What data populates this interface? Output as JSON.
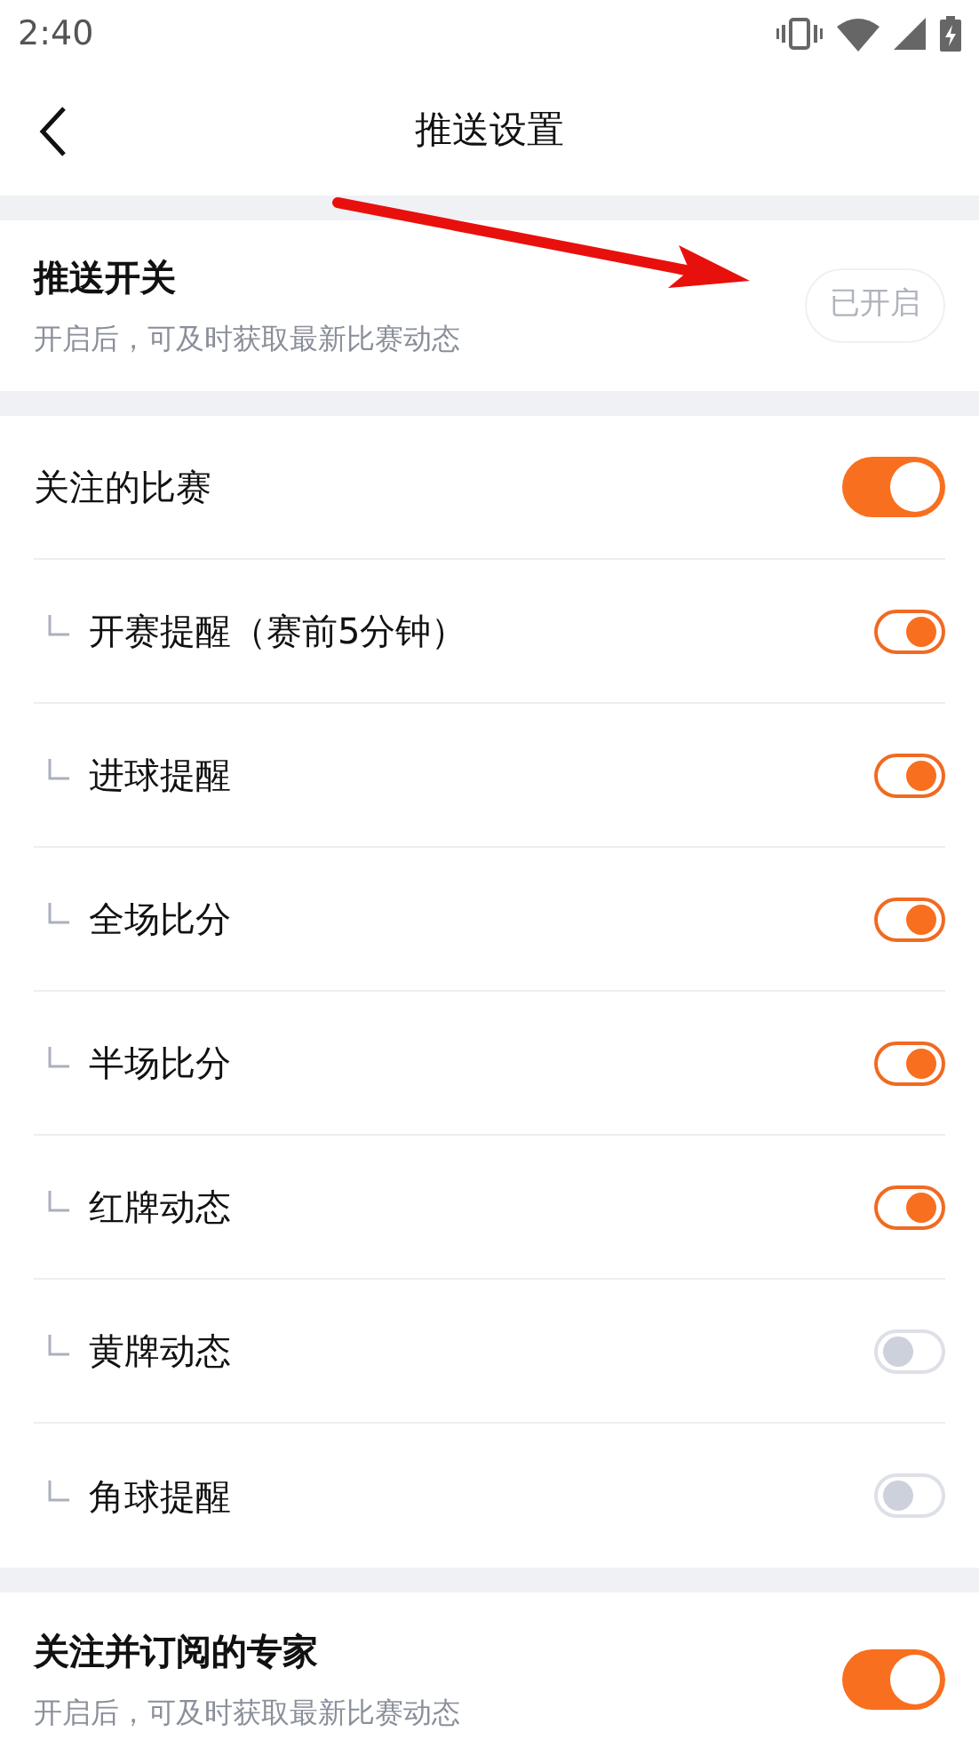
{
  "status_bar": {
    "time": "2:40"
  },
  "nav": {
    "title": "推送设置"
  },
  "push": {
    "title": "推送开关",
    "description": "开启后，可及时获取最新比赛动态",
    "status": "已开启"
  },
  "matches": {
    "title": "关注的比赛",
    "on": true,
    "items": [
      {
        "label": "开赛提醒（赛前5分钟）",
        "on": true
      },
      {
        "label": "进球提醒",
        "on": true
      },
      {
        "label": "全场比分",
        "on": true
      },
      {
        "label": "半场比分",
        "on": true
      },
      {
        "label": "红牌动态",
        "on": true
      },
      {
        "label": "黄牌动态",
        "on": false
      },
      {
        "label": "角球提醒",
        "on": false
      }
    ]
  },
  "experts": {
    "title": "关注并订阅的专家",
    "description": "开启后，可及时获取最新比赛动态",
    "on": true
  }
}
